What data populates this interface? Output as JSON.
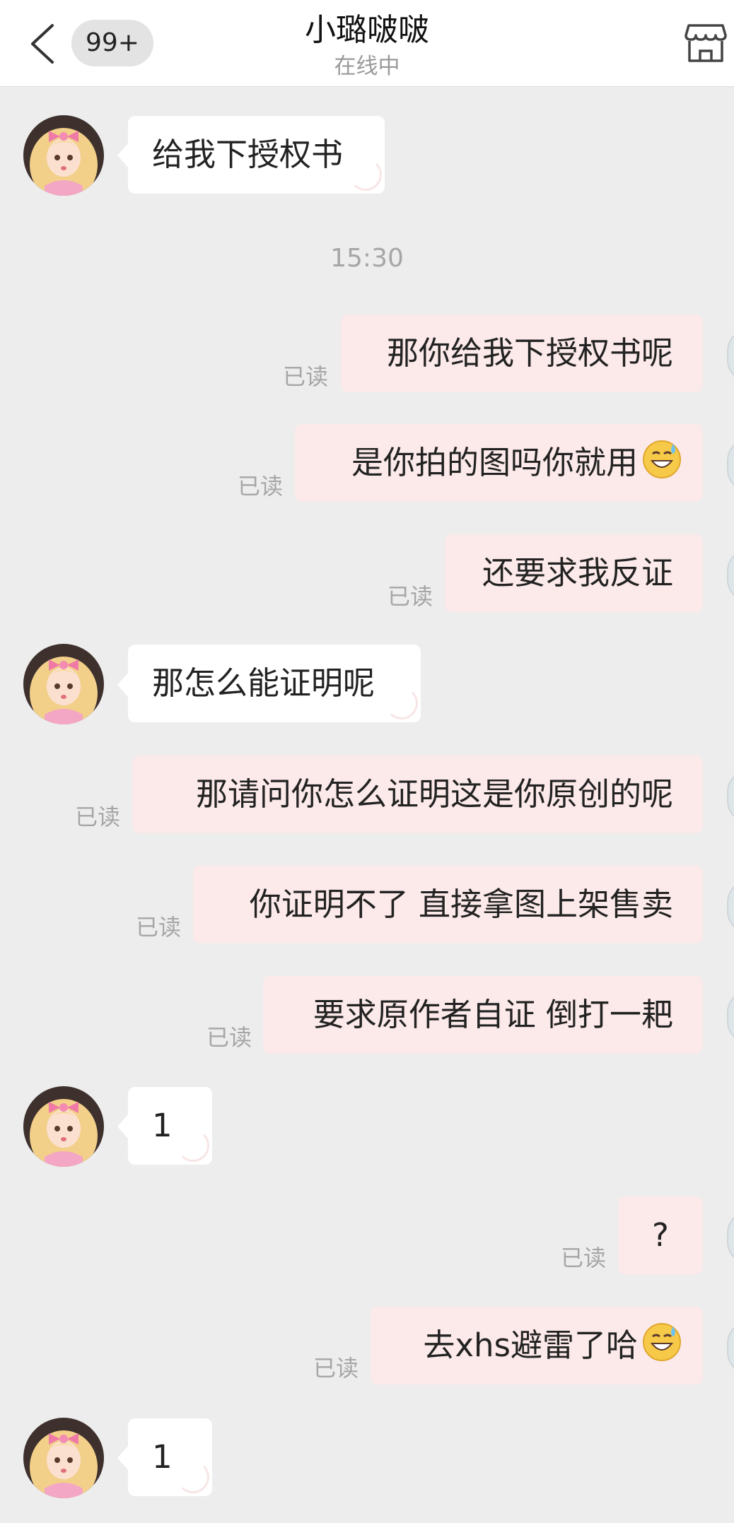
{
  "header": {
    "back_icon": "chevron-left-icon",
    "unread_badge": "99+",
    "contact_name": "小璐啵啵",
    "online_status": "在线中",
    "shop_icon": "storefront-icon"
  },
  "timestamp": "15:30",
  "read_label": "已读",
  "messages": [
    {
      "side": "in",
      "text": "给我下授权书"
    },
    {
      "side": "out",
      "text": "那你给我下授权书呢",
      "status": "已读"
    },
    {
      "side": "out",
      "text": "是你拍的图吗你就用",
      "status": "已读",
      "emoji": "grinning-sweat-emoji"
    },
    {
      "side": "out",
      "text": "还要求我反证",
      "status": "已读"
    },
    {
      "side": "in",
      "text": "那怎么能证明呢"
    },
    {
      "side": "out",
      "text": "那请问你怎么证明这是你原创的呢",
      "status": "已读"
    },
    {
      "side": "out",
      "text": "你证明不了 直接拿图上架售卖",
      "status": "已读"
    },
    {
      "side": "out",
      "text": "要求原作者自证 倒打一耙",
      "status": "已读"
    },
    {
      "side": "in",
      "text": "1"
    },
    {
      "side": "out",
      "text": "?",
      "status": "已读"
    },
    {
      "side": "out",
      "text": "去xhs避雷了哈",
      "status": "已读",
      "emoji": "grinning-sweat-emoji"
    },
    {
      "side": "in",
      "text": "1"
    }
  ],
  "colors": {
    "background": "#ededed",
    "incoming_bubble": "#ffffff",
    "outgoing_bubble": "#fce9e9",
    "read_text": "#a6a6a6"
  }
}
